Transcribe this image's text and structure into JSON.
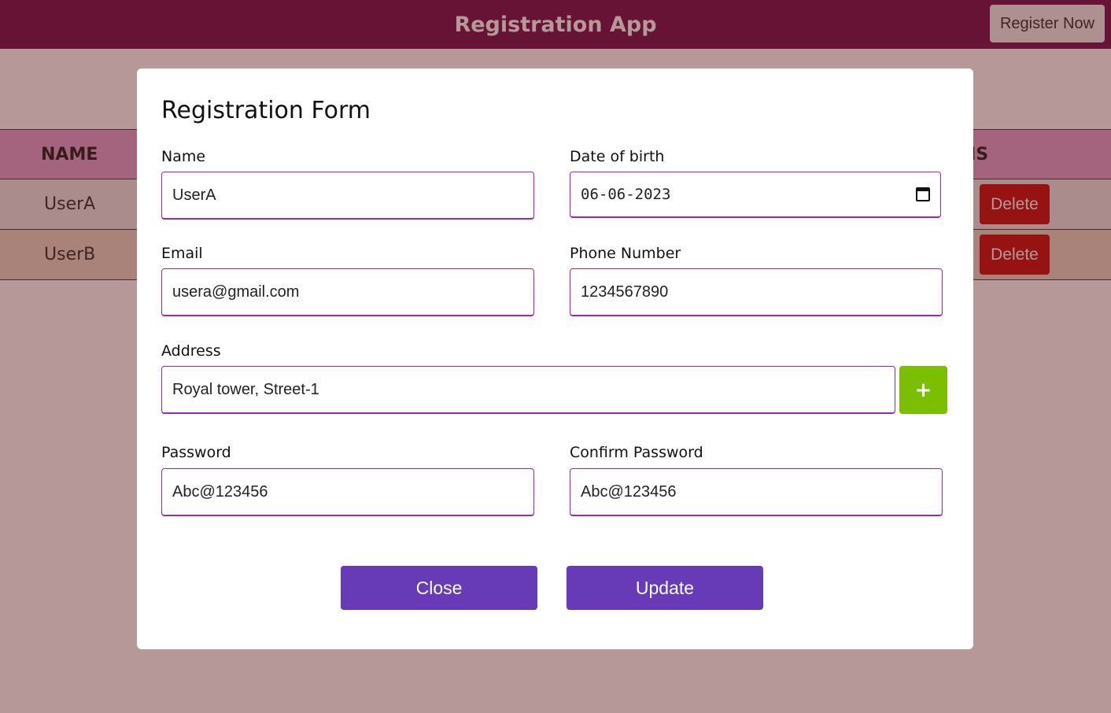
{
  "header": {
    "title": "Registration App",
    "register_button": "Register Now"
  },
  "table": {
    "columns": {
      "name": "NAME",
      "actions_partial": "TIONS"
    },
    "rows": [
      {
        "name": "UserA",
        "delete_label": "Delete"
      },
      {
        "name": "UserB",
        "delete_label": "Delete"
      }
    ]
  },
  "modal": {
    "title": "Registration Form",
    "name": {
      "label": "Name",
      "value": "UserA"
    },
    "dob": {
      "label": "Date of birth",
      "value": "06-06-2023"
    },
    "email": {
      "label": "Email",
      "value": "usera@gmail.com"
    },
    "phone": {
      "label": "Phone Number",
      "value": "1234567890"
    },
    "address": {
      "label": "Address",
      "value": "Royal tower, Street-1",
      "add_label": "+"
    },
    "password": {
      "label": "Password",
      "value": "Abc@123456"
    },
    "confirm_password": {
      "label": "Confirm Password",
      "value": "Abc@123456"
    },
    "close_label": "Close",
    "update_label": "Update"
  },
  "colors": {
    "header": "#660044",
    "accent_border": "#9c27b0",
    "primary_button": "#673ab7",
    "add_button": "#7cbf00",
    "delete_button": "#c00000"
  }
}
